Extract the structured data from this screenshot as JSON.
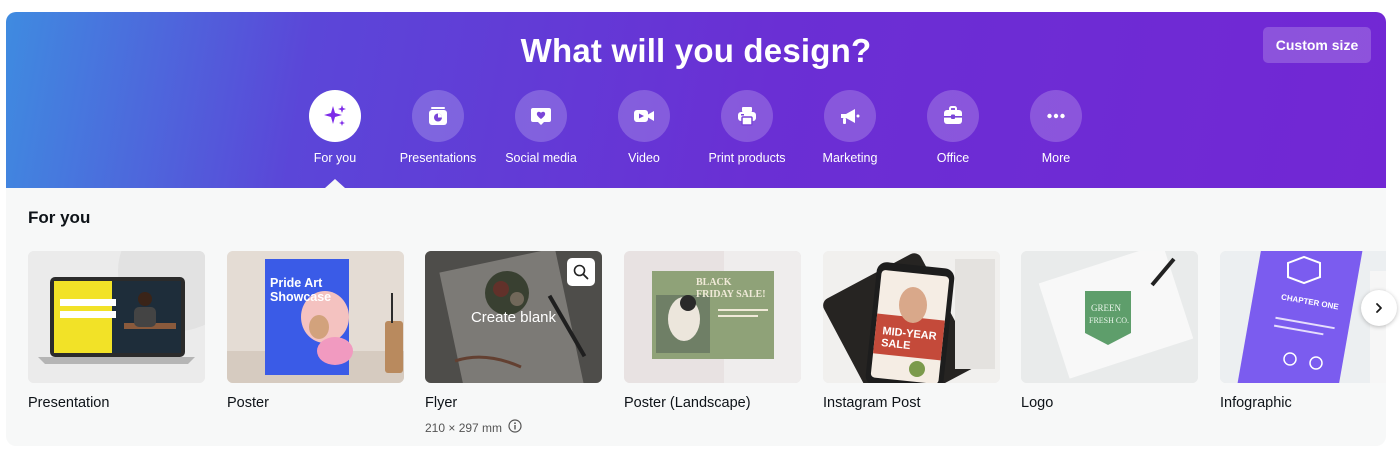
{
  "hero": {
    "title": "What will you design?",
    "custom_size_label": "Custom size"
  },
  "categories": [
    {
      "label": "For you",
      "icon": "sparkle-icon",
      "active": true
    },
    {
      "label": "Presentations",
      "icon": "presentation-icon"
    },
    {
      "label": "Social media",
      "icon": "heart-icon"
    },
    {
      "label": "Video",
      "icon": "video-camera-icon"
    },
    {
      "label": "Print products",
      "icon": "printer-icon"
    },
    {
      "label": "Marketing",
      "icon": "megaphone-icon"
    },
    {
      "label": "Office",
      "icon": "briefcase-icon"
    },
    {
      "label": "More",
      "icon": "ellipsis-icon"
    }
  ],
  "section": {
    "title": "For you"
  },
  "cards": [
    {
      "label": "Presentation"
    },
    {
      "label": "Poster",
      "thumb_text": [
        "Pride Art",
        "Showcase"
      ]
    },
    {
      "label": "Flyer",
      "sub": "210 × 297 mm",
      "overlay": "Create blank"
    },
    {
      "label": "Poster (Landscape)",
      "thumb_text": [
        "BLACK",
        "FRIDAY SALE!"
      ]
    },
    {
      "label": "Instagram Post",
      "thumb_text": [
        "MID-YEAR",
        "SALE"
      ]
    },
    {
      "label": "Logo",
      "thumb_text": [
        "GREEN",
        "FRESH CO."
      ]
    },
    {
      "label": "Infographic",
      "thumb_text": [
        "CHAPTER ONE"
      ]
    }
  ],
  "colors": {
    "hero_start": "#3f8be0",
    "hero_end": "#7227d4",
    "accent": "#7d2ae8"
  }
}
